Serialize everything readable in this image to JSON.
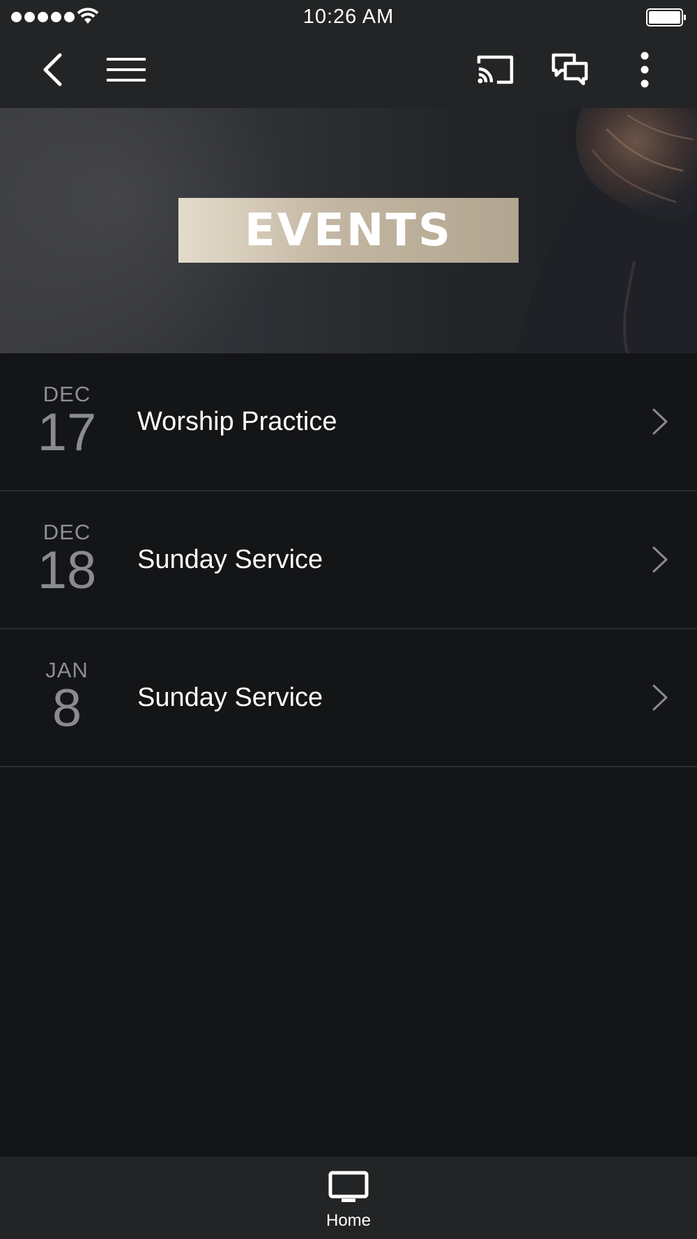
{
  "status_bar": {
    "time": "10:26 AM",
    "signal_icon": "signal-dots-icon",
    "wifi_icon": "wifi-icon",
    "battery_icon": "battery-icon"
  },
  "toolbar": {
    "back_icon": "chevron-left-icon",
    "menu_icon": "hamburger-menu-icon",
    "cast_icon": "cast-icon",
    "chat_icon": "chat-bubbles-icon",
    "more_icon": "more-vertical-icon"
  },
  "hero": {
    "title": "EVENTS",
    "banner_color": "#c3b6a2"
  },
  "events": [
    {
      "month": "DEC",
      "day": "17",
      "title": "Worship Practice"
    },
    {
      "month": "DEC",
      "day": "18",
      "title": "Sunday Service"
    },
    {
      "month": "JAN",
      "day": "8",
      "title": "Sunday Service"
    }
  ],
  "tab_bar": {
    "home_label": "Home",
    "home_icon": "tv-monitor-icon"
  },
  "colors": {
    "background": "#141517",
    "bar_background": "#232425",
    "date_text": "#8e8f93",
    "divider": "#2c2d30"
  }
}
